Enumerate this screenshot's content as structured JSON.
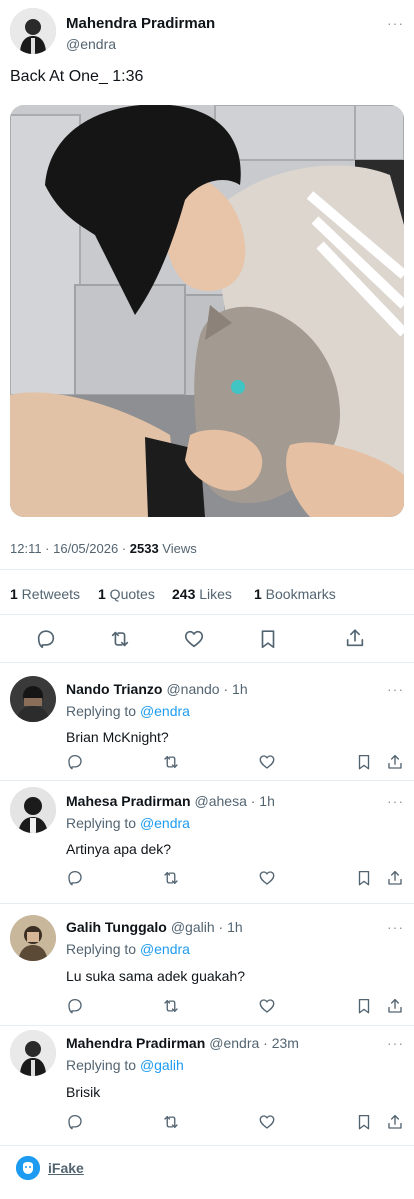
{
  "post": {
    "author_name": "Mahendra Pradirman",
    "author_handle": "@endra",
    "more": "···",
    "text": "Back At One_ 1:36",
    "time_date": "12:11 · 16/05/2026 · ",
    "views_count": "2533",
    "views_label": " Views"
  },
  "stats": {
    "retweets_count": "1",
    "retweets_label": " Retweets",
    "quotes_count": "1",
    "quotes_label": " Quotes",
    "likes_count": "243",
    "likes_label": " Likes",
    "bookmarks_count": "1",
    "bookmarks_label": " Bookmarks"
  },
  "actions": {
    "icons": [
      "reply-icon",
      "retweet-icon",
      "like-icon",
      "bookmark-icon",
      "share-icon"
    ]
  },
  "replies": [
    {
      "name": "Nando Trianzo",
      "handle_time": "@nando · 1h",
      "replying_prefix": "Replying to ",
      "mention": "@endra",
      "text": "Brian McKnight?"
    },
    {
      "name": "Mahesa Pradirman",
      "handle_time": "@ahesa · 1h",
      "replying_prefix": "Replying to ",
      "mention": "@endra",
      "text": "Artinya apa dek?"
    },
    {
      "name": "Galih Tunggalo",
      "handle_time": "@galih · 1h",
      "replying_prefix": "Replying to ",
      "mention": "@endra",
      "text": "Lu suka sama adek guakah?"
    },
    {
      "name": "Mahendra Pradirman",
      "handle_time": "@endra · 23m",
      "replying_prefix": "Replying to ",
      "mention": "@galih",
      "text": "Brisik"
    }
  ],
  "footer": {
    "label": "iFake"
  },
  "colors": {
    "accent": "#1d9bf0",
    "text": "#0f1419",
    "secondary": "#536471",
    "divider": "#e6ecf0"
  }
}
